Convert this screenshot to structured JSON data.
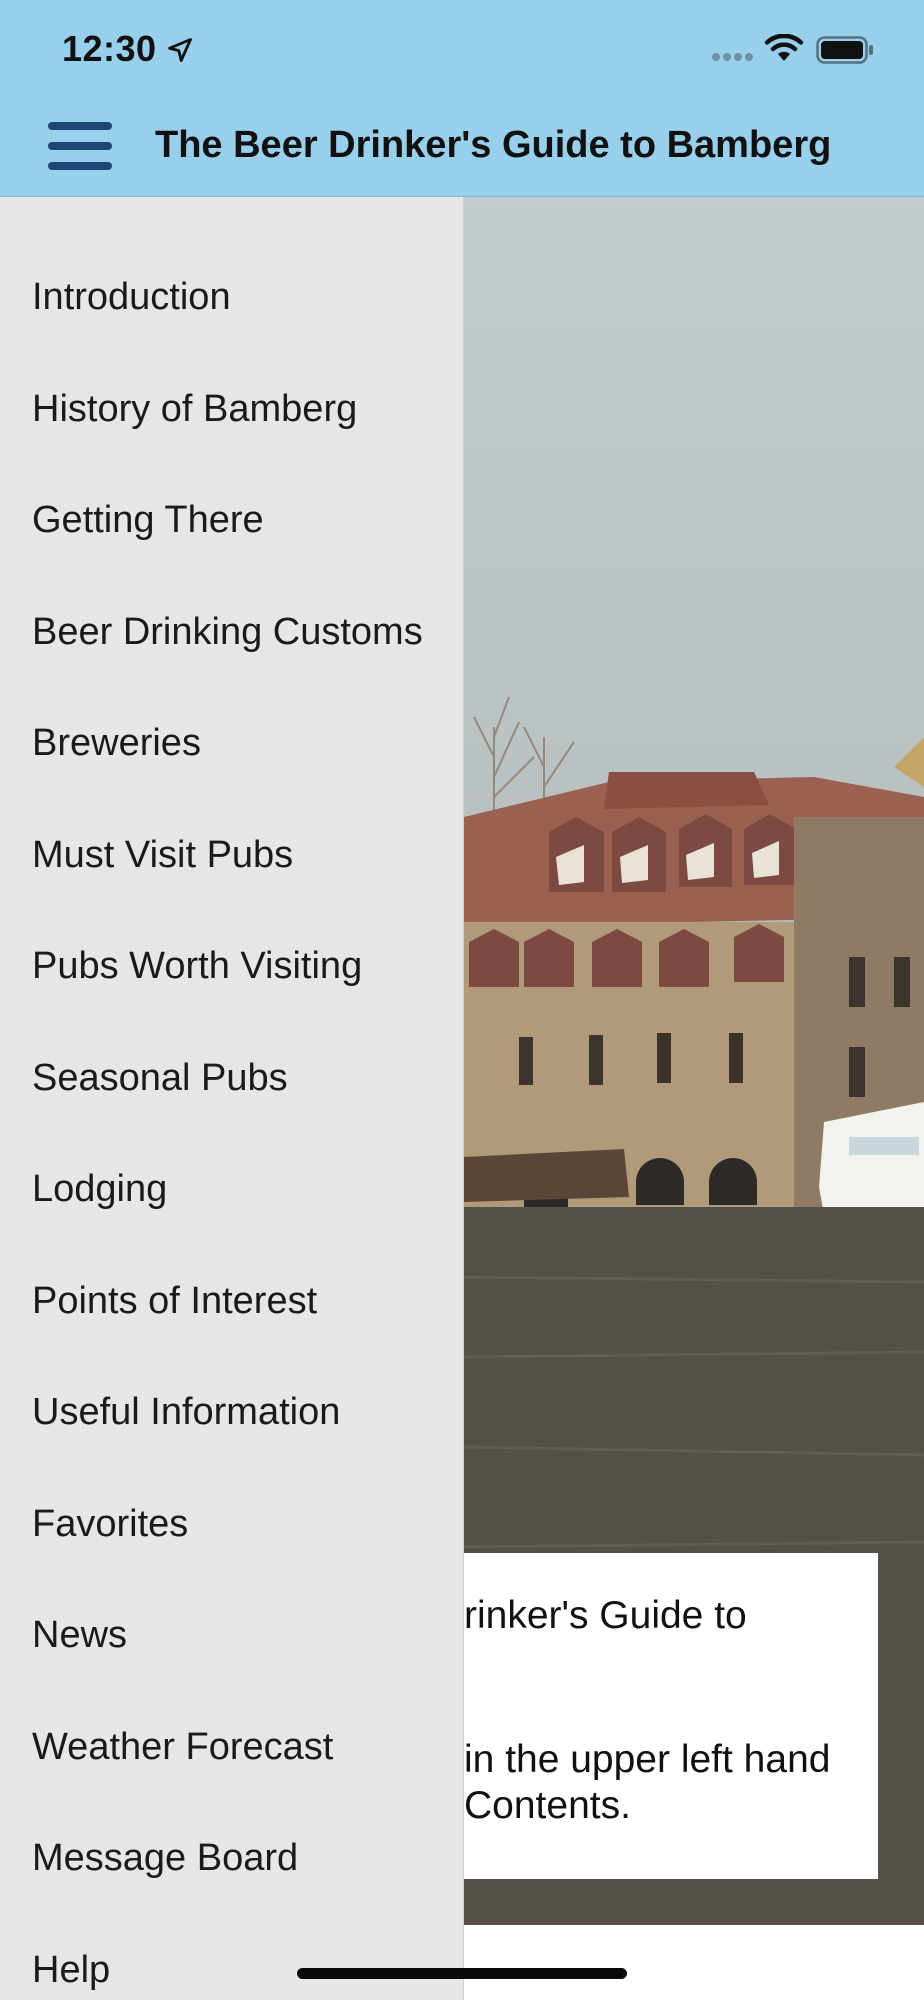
{
  "status_bar": {
    "time": "12:30",
    "icons": [
      "location-arrow-icon",
      "signal-icon",
      "wifi-icon",
      "battery-icon"
    ]
  },
  "header": {
    "title": "The Beer Drinker's Guide to Bamberg",
    "menu_icon": "hamburger-menu-icon",
    "background_color": "#98d0ec",
    "menu_icon_color": "#1b4676"
  },
  "drawer": {
    "background_color": "#e6e6e6",
    "items": [
      {
        "label": "Introduction"
      },
      {
        "label": "History of Bamberg"
      },
      {
        "label": "Getting There"
      },
      {
        "label": "Beer Drinking Customs"
      },
      {
        "label": "Breweries"
      },
      {
        "label": "Must Visit Pubs"
      },
      {
        "label": "Pubs Worth Visiting"
      },
      {
        "label": "Seasonal Pubs"
      },
      {
        "label": "Lodging"
      },
      {
        "label": "Points of Interest"
      },
      {
        "label": "Useful Information"
      },
      {
        "label": "Favorites"
      },
      {
        "label": "News"
      },
      {
        "label": "Weather Forecast"
      },
      {
        "label": "Message Board"
      },
      {
        "label": "Help"
      }
    ]
  },
  "main": {
    "card_lines": [
      "rinker's Guide to",
      "in the upper left hand",
      "Contents."
    ]
  }
}
